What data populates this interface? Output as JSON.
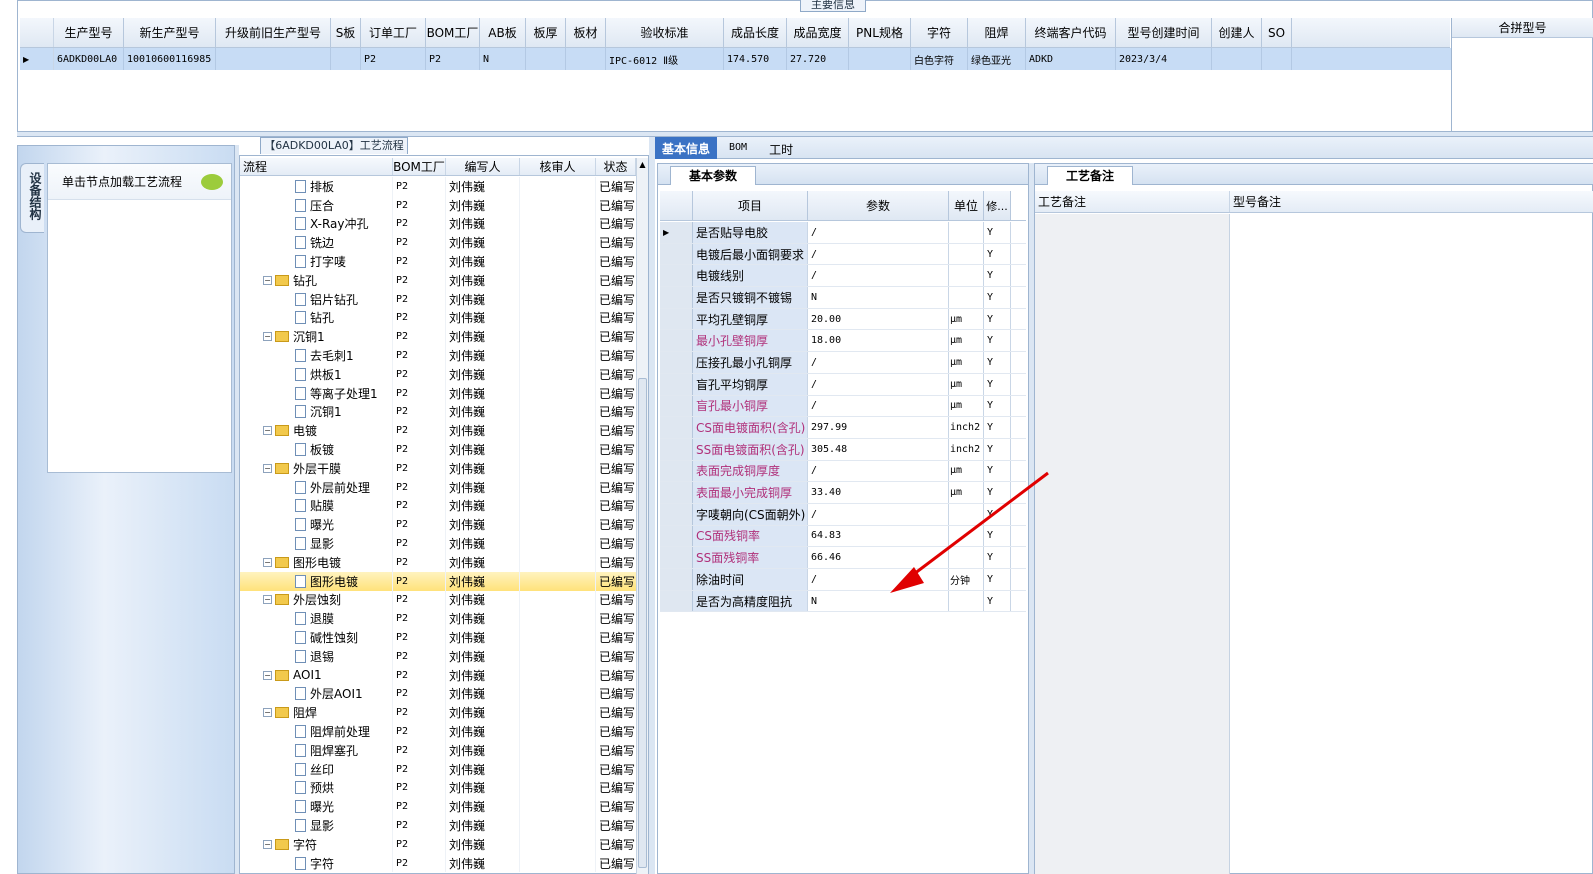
{
  "top": {
    "title": "主要信息",
    "merge": "合拼型号",
    "cols": [
      "生产型号",
      "新生产型号",
      "升级前旧生产型号",
      "S板",
      "订单工厂",
      "BOM工厂",
      "AB板",
      "板厚",
      "板材",
      "验收标准",
      "成品长度",
      "成品宽度",
      "PNL规格",
      "字符",
      "阻焊",
      "终端客户代码",
      "型号创建时间",
      "创建人",
      "SO"
    ],
    "row": [
      "6ADKD00LA0",
      "10010600116985",
      "",
      "",
      "P2",
      "P2",
      "N",
      "",
      "",
      "IPC-6012 Ⅱ级",
      "174.570",
      "27.720",
      "",
      "白色字符",
      "绿色亚光",
      "ADKD",
      "2023/3/4",
      "",
      ""
    ]
  },
  "side": {
    "vtab": "设备结构",
    "hint": "单击节点加载工艺流程"
  },
  "tree": {
    "title": "【6ADKD00LA0】工艺流程",
    "cols": [
      "流程",
      "BOM工厂",
      "编写人",
      "核审人",
      "状态"
    ],
    "rows": [
      {
        "n": "排板",
        "l": 2,
        "f": "P2",
        "w": "刘伟巍",
        "s": "已编写"
      },
      {
        "n": "压合",
        "l": 2,
        "f": "P2",
        "w": "刘伟巍",
        "s": "已编写"
      },
      {
        "n": "X-Ray冲孔",
        "l": 2,
        "f": "P2",
        "w": "刘伟巍",
        "s": "已编写"
      },
      {
        "n": "铣边",
        "l": 2,
        "f": "P2",
        "w": "刘伟巍",
        "s": "已编写"
      },
      {
        "n": "打字唛",
        "l": 2,
        "f": "P2",
        "w": "刘伟巍",
        "s": "已编写"
      },
      {
        "n": "钻孔",
        "l": 1,
        "f": "P2",
        "w": "刘伟巍",
        "s": "已编写"
      },
      {
        "n": "铝片钻孔",
        "l": 2,
        "f": "P2",
        "w": "刘伟巍",
        "s": "已编写"
      },
      {
        "n": "钻孔",
        "l": 2,
        "f": "P2",
        "w": "刘伟巍",
        "s": "已编写"
      },
      {
        "n": "沉铜1",
        "l": 1,
        "f": "P2",
        "w": "刘伟巍",
        "s": "已编写"
      },
      {
        "n": "去毛刺1",
        "l": 2,
        "f": "P2",
        "w": "刘伟巍",
        "s": "已编写"
      },
      {
        "n": "烘板1",
        "l": 2,
        "f": "P2",
        "w": "刘伟巍",
        "s": "已编写"
      },
      {
        "n": "等离子处理1",
        "l": 2,
        "f": "P2",
        "w": "刘伟巍",
        "s": "已编写"
      },
      {
        "n": "沉铜1",
        "l": 2,
        "f": "P2",
        "w": "刘伟巍",
        "s": "已编写"
      },
      {
        "n": "电镀",
        "l": 1,
        "f": "P2",
        "w": "刘伟巍",
        "s": "已编写"
      },
      {
        "n": "板镀",
        "l": 2,
        "f": "P2",
        "w": "刘伟巍",
        "s": "已编写"
      },
      {
        "n": "外层干膜",
        "l": 1,
        "f": "P2",
        "w": "刘伟巍",
        "s": "已编写"
      },
      {
        "n": "外层前处理",
        "l": 2,
        "f": "P2",
        "w": "刘伟巍",
        "s": "已编写"
      },
      {
        "n": "贴膜",
        "l": 2,
        "f": "P2",
        "w": "刘伟巍",
        "s": "已编写"
      },
      {
        "n": "曝光",
        "l": 2,
        "f": "P2",
        "w": "刘伟巍",
        "s": "已编写"
      },
      {
        "n": "显影",
        "l": 2,
        "f": "P2",
        "w": "刘伟巍",
        "s": "已编写"
      },
      {
        "n": "图形电镀",
        "l": 1,
        "f": "P2",
        "w": "刘伟巍",
        "s": "已编写"
      },
      {
        "n": "图形电镀",
        "l": 2,
        "f": "P2",
        "w": "刘伟巍",
        "s": "已编写",
        "sel": true
      },
      {
        "n": "外层蚀刻",
        "l": 1,
        "f": "P2",
        "w": "刘伟巍",
        "s": "已编写"
      },
      {
        "n": "退膜",
        "l": 2,
        "f": "P2",
        "w": "刘伟巍",
        "s": "已编写"
      },
      {
        "n": "碱性蚀刻",
        "l": 2,
        "f": "P2",
        "w": "刘伟巍",
        "s": "已编写"
      },
      {
        "n": "退锡",
        "l": 2,
        "f": "P2",
        "w": "刘伟巍",
        "s": "已编写"
      },
      {
        "n": "AOI1",
        "l": 1,
        "f": "P2",
        "w": "刘伟巍",
        "s": "已编写"
      },
      {
        "n": "外层AOI1",
        "l": 2,
        "f": "P2",
        "w": "刘伟巍",
        "s": "已编写"
      },
      {
        "n": "阻焊",
        "l": 1,
        "f": "P2",
        "w": "刘伟巍",
        "s": "已编写"
      },
      {
        "n": "阻焊前处理",
        "l": 2,
        "f": "P2",
        "w": "刘伟巍",
        "s": "已编写"
      },
      {
        "n": "阻焊塞孔",
        "l": 2,
        "f": "P2",
        "w": "刘伟巍",
        "s": "已编写"
      },
      {
        "n": "丝印",
        "l": 2,
        "f": "P2",
        "w": "刘伟巍",
        "s": "已编写"
      },
      {
        "n": "预烘",
        "l": 2,
        "f": "P2",
        "w": "刘伟巍",
        "s": "已编写"
      },
      {
        "n": "曝光",
        "l": 2,
        "f": "P2",
        "w": "刘伟巍",
        "s": "已编写"
      },
      {
        "n": "显影",
        "l": 2,
        "f": "P2",
        "w": "刘伟巍",
        "s": "已编写"
      },
      {
        "n": "字符",
        "l": 1,
        "f": "P2",
        "w": "刘伟巍",
        "s": "已编写"
      },
      {
        "n": "字符",
        "l": 2,
        "f": "P2",
        "w": "刘伟巍",
        "s": "已编写"
      }
    ]
  },
  "info": {
    "tabs": [
      "基本信息",
      "BOM",
      "工时"
    ],
    "sub": "基本参数",
    "cols": [
      "项目",
      "参数",
      "单位",
      "修..."
    ],
    "rows": [
      {
        "k": "是否贴导电胶",
        "v": "/",
        "u": "",
        "m": "Y",
        "pink": false
      },
      {
        "k": "电镀后最小面铜要求",
        "v": "/",
        "u": "",
        "m": "Y",
        "pink": false
      },
      {
        "k": "电镀线别",
        "v": "/",
        "u": "",
        "m": "Y",
        "pink": false
      },
      {
        "k": "是否只镀铜不镀锡",
        "v": "N",
        "u": "",
        "m": "Y",
        "pink": false
      },
      {
        "k": "平均孔壁铜厚",
        "v": "20.00",
        "u": "μm",
        "m": "Y",
        "pink": false
      },
      {
        "k": "最小孔壁铜厚",
        "v": "18.00",
        "u": "μm",
        "m": "Y",
        "pink": true
      },
      {
        "k": "压接孔最小孔铜厚",
        "v": "/",
        "u": "μm",
        "m": "Y",
        "pink": false
      },
      {
        "k": "盲孔平均铜厚",
        "v": "/",
        "u": "μm",
        "m": "Y",
        "pink": false
      },
      {
        "k": "盲孔最小铜厚",
        "v": "/",
        "u": "μm",
        "m": "Y",
        "pink": true
      },
      {
        "k": "CS面电镀面积(含孔)",
        "v": "297.99",
        "u": "inch2",
        "m": "Y",
        "pink": true
      },
      {
        "k": "SS面电镀面积(含孔)",
        "v": "305.48",
        "u": "inch2",
        "m": "Y",
        "pink": true
      },
      {
        "k": "表面完成铜厚度",
        "v": "/",
        "u": "μm",
        "m": "Y",
        "pink": true
      },
      {
        "k": "表面最小完成铜厚",
        "v": "33.40",
        "u": "μm",
        "m": "Y",
        "pink": true
      },
      {
        "k": "字唛朝向(CS面朝外)",
        "v": "/",
        "u": "",
        "m": "Y",
        "pink": false
      },
      {
        "k": "CS面残铜率",
        "v": "64.83",
        "u": "",
        "m": "Y",
        "pink": true
      },
      {
        "k": "SS面残铜率",
        "v": "66.46",
        "u": "",
        "m": "Y",
        "pink": true
      },
      {
        "k": "除油时间",
        "v": "/",
        "u": "分钟",
        "m": "Y",
        "pink": false
      },
      {
        "k": "是否为高精度阻抗",
        "v": "N",
        "u": "",
        "m": "Y",
        "pink": false
      }
    ]
  },
  "remark": {
    "tab": "工艺备注",
    "c1": "工艺备注",
    "c2": "型号备注"
  }
}
